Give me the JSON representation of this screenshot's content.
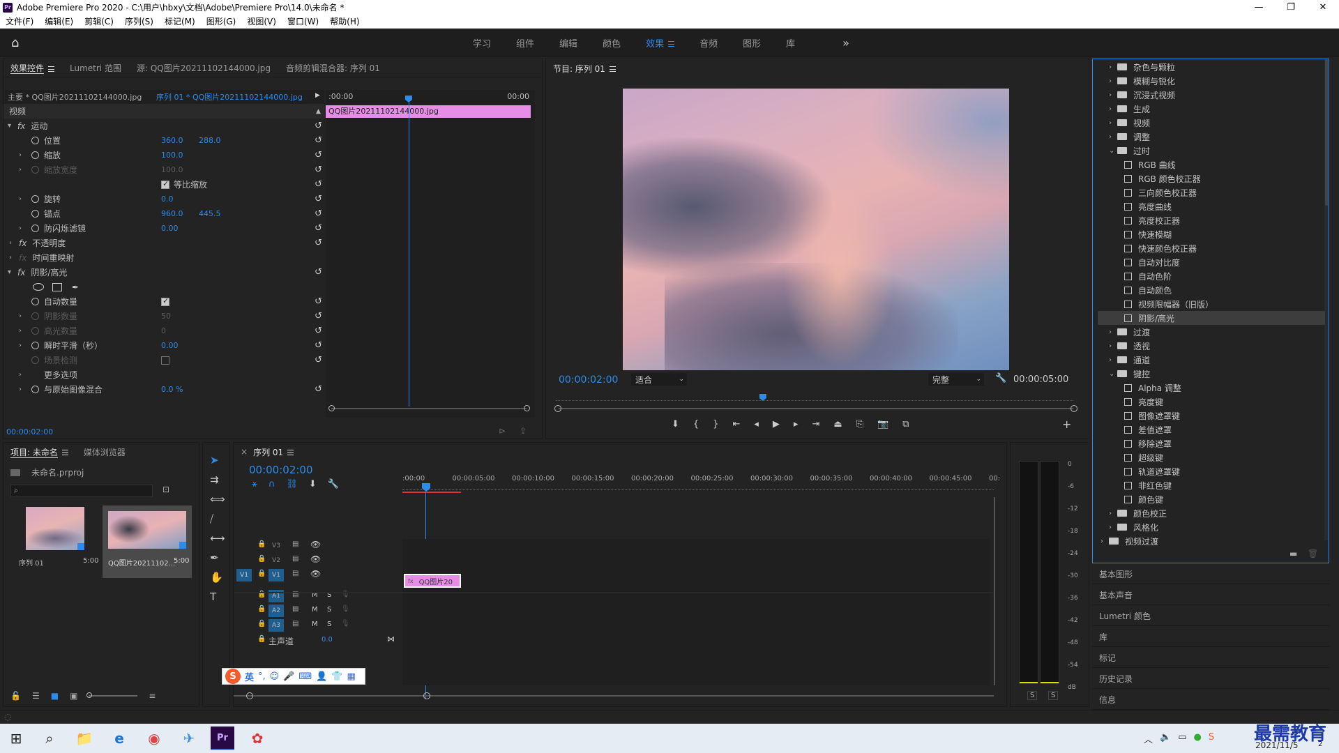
{
  "window": {
    "title": "Adobe Premiere Pro 2020 - C:\\用户\\hbxy\\文档\\Adobe\\Premiere Pro\\14.0\\未命名 *",
    "controls": [
      "—",
      "❐",
      "✕"
    ]
  },
  "menu": [
    "文件(F)",
    "编辑(E)",
    "剪辑(C)",
    "序列(S)",
    "标记(M)",
    "图形(G)",
    "视图(V)",
    "窗口(W)",
    "帮助(H)"
  ],
  "workspaces": {
    "tabs": [
      "学习",
      "组件",
      "编辑",
      "颜色",
      "效果",
      "音频",
      "图形",
      "库"
    ],
    "active": "效果",
    "more": "»"
  },
  "effect_controls": {
    "tabs": [
      "效果控件",
      "Lumetri 范围",
      "源: QQ图片20211102144000.jpg",
      "音频剪辑混合器: 序列 01"
    ],
    "master": "主要 * QQ图片20211102144000.jpg",
    "sequence": "序列 01 * QQ图片20211102144000.jpg",
    "section_video": "视频",
    "timecode_start": ":00:00",
    "timecode_end": "00:00",
    "clip_name": "QQ图片20211102144000.jpg",
    "current_time": "00:00:02:00",
    "motion": {
      "name": "运动",
      "position_label": "位置",
      "position_x": "360.0",
      "position_y": "288.0",
      "scale_label": "缩放",
      "scale": "100.0",
      "scale_width_label": "缩放宽度",
      "scale_width": "100.0",
      "uniform_label": "等比缩放",
      "rotation_label": "旋转",
      "rotation": "0.0",
      "anchor_label": "锚点",
      "anchor_x": "960.0",
      "anchor_y": "445.5",
      "flicker_label": "防闪烁滤镜",
      "flicker": "0.00"
    },
    "opacity": "不透明度",
    "time_remap": "时间重映射",
    "shadow": {
      "name": "阴影/高光",
      "auto_label": "自动数量",
      "shadow_amount_label": "阴影数量",
      "shadow_amount": "50",
      "highlight_label": "高光数量",
      "highlight": "0",
      "temporal_label": "瞬时平滑（秒）",
      "temporal": "0.00",
      "scene_label": "场景检测",
      "more_label": "更多选项",
      "blend_label": "与原始图像混合",
      "blend": "0.0 %"
    }
  },
  "program": {
    "title": "节目: 序列 01",
    "timecode": "00:00:02:00",
    "fit": "适合",
    "quality": "完整",
    "duration": "00:00:05:00",
    "playhead": 0.4
  },
  "project": {
    "tabs": [
      "项目: 未命名",
      "媒体浏览器"
    ],
    "file": "未命名.prproj",
    "search_placeholder": "",
    "items": [
      {
        "name": "序列 01",
        "duration": "5:00"
      },
      {
        "name": "QQ图片20211102...",
        "duration": "5:00"
      }
    ]
  },
  "timeline": {
    "title": "序列 01",
    "timecode": "00:00:02:00",
    "ruler": [
      ":00:00",
      "00:00:05:00",
      "00:00:10:00",
      "00:00:15:00",
      "00:00:20:00",
      "00:00:25:00",
      "00:00:30:00",
      "00:00:35:00",
      "00:00:40:00",
      "00:00:45:00",
      "00:"
    ],
    "video_tracks": [
      "V3",
      "V2",
      "V1"
    ],
    "audio_tracks": [
      "A1",
      "A2",
      "A3"
    ],
    "source_v": "V1",
    "master_label": "主声道",
    "master_value": "0.0",
    "clip": "QQ图片20",
    "mute": "M",
    "solo": "S"
  },
  "meter": {
    "ticks": [
      "0",
      "-6",
      "-12",
      "-18",
      "-24",
      "-30",
      "-36",
      "-42",
      "-48",
      "-54",
      "dB"
    ],
    "solo": [
      "S",
      "S"
    ]
  },
  "effects_tree": [
    {
      "label": "杂色与颗粒",
      "type": "folder",
      "level": 1,
      "open": false
    },
    {
      "label": "模糊与锐化",
      "type": "folder",
      "level": 1,
      "open": false
    },
    {
      "label": "沉浸式视频",
      "type": "folder",
      "level": 1,
      "open": false
    },
    {
      "label": "生成",
      "type": "folder",
      "level": 1,
      "open": false
    },
    {
      "label": "视频",
      "type": "folder",
      "level": 1,
      "open": false
    },
    {
      "label": "调整",
      "type": "folder",
      "level": 1,
      "open": false
    },
    {
      "label": "过时",
      "type": "folder",
      "level": 1,
      "open": true
    },
    {
      "label": "RGB 曲线",
      "type": "fx",
      "level": 2
    },
    {
      "label": "RGB 颜色校正器",
      "type": "fx",
      "level": 2
    },
    {
      "label": "三向颜色校正器",
      "type": "fx",
      "level": 2
    },
    {
      "label": "亮度曲线",
      "type": "fx",
      "level": 2
    },
    {
      "label": "亮度校正器",
      "type": "fx",
      "level": 2
    },
    {
      "label": "快速模糊",
      "type": "fx",
      "level": 2
    },
    {
      "label": "快速颜色校正器",
      "type": "fx",
      "level": 2
    },
    {
      "label": "自动对比度",
      "type": "fx",
      "level": 2
    },
    {
      "label": "自动色阶",
      "type": "fx",
      "level": 2
    },
    {
      "label": "自动颜色",
      "type": "fx",
      "level": 2
    },
    {
      "label": "视频限幅器（旧版）",
      "type": "fx",
      "level": 2
    },
    {
      "label": "阴影/高光",
      "type": "fx",
      "level": 2,
      "selected": true
    },
    {
      "label": "过渡",
      "type": "folder",
      "level": 1,
      "open": false
    },
    {
      "label": "透视",
      "type": "folder",
      "level": 1,
      "open": false
    },
    {
      "label": "通道",
      "type": "folder",
      "level": 1,
      "open": false
    },
    {
      "label": "键控",
      "type": "folder",
      "level": 1,
      "open": true
    },
    {
      "label": "Alpha 调整",
      "type": "fx",
      "level": 2
    },
    {
      "label": "亮度键",
      "type": "fx",
      "level": 2
    },
    {
      "label": "图像遮罩键",
      "type": "fx",
      "level": 2
    },
    {
      "label": "差值遮罩",
      "type": "fx",
      "level": 2
    },
    {
      "label": "移除遮罩",
      "type": "fx",
      "level": 2
    },
    {
      "label": "超级键",
      "type": "fx",
      "level": 2
    },
    {
      "label": "轨道遮罩键",
      "type": "fx",
      "level": 2
    },
    {
      "label": "非红色键",
      "type": "fx",
      "level": 2
    },
    {
      "label": "颜色键",
      "type": "fx",
      "level": 2
    },
    {
      "label": "颜色校正",
      "type": "folder",
      "level": 1,
      "open": false
    },
    {
      "label": "风格化",
      "type": "folder",
      "level": 1,
      "open": false
    },
    {
      "label": "视频过渡",
      "type": "folder",
      "level": 0,
      "open": false
    }
  ],
  "side_panels": [
    "基本图形",
    "基本声音",
    "Lumetri 颜色",
    "库",
    "标记",
    "历史记录",
    "信息"
  ],
  "ime": {
    "lang": "英"
  },
  "taskbar": {
    "date": "2021/11/5",
    "clock": "2",
    "watermark": "最需教育"
  },
  "colors": {
    "accent": "#2d8ceb",
    "clip": "#e68ee6",
    "selected": "#3d3d3d"
  }
}
